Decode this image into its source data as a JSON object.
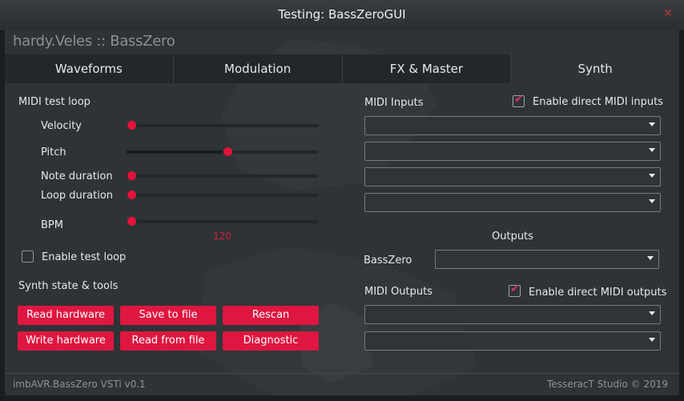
{
  "window": {
    "title": "Testing: BassZeroGUI",
    "close_glyph": "✕"
  },
  "brand": "hardy.Veles :: BassZero",
  "tabs": [
    {
      "label": "Waveforms",
      "active": false
    },
    {
      "label": "Modulation",
      "active": false
    },
    {
      "label": "FX & Master",
      "active": false
    },
    {
      "label": "Synth",
      "active": true
    }
  ],
  "midi_test_loop": {
    "heading": "MIDI test loop",
    "sliders": {
      "velocity": {
        "label": "Velocity",
        "value": 0.0
      },
      "pitch": {
        "label": "Pitch",
        "value": 0.5
      },
      "note_duration": {
        "label": "Note duration",
        "value": 0.0
      },
      "loop_duration": {
        "label": "Loop duration",
        "value": 0.0
      },
      "bpm": {
        "label": "BPM",
        "value": 0.0,
        "display": "120"
      }
    },
    "enable_test_loop": {
      "label": "Enable test loop",
      "checked": false
    }
  },
  "synth_tools": {
    "heading": "Synth state & tools",
    "buttons": {
      "read_hardware": "Read hardware",
      "save_to_file": "Save to file",
      "rescan": "Rescan",
      "write_hardware": "Write hardware",
      "read_from_file": "Read from file",
      "diagnostic": "Diagnostic"
    }
  },
  "midi_inputs": {
    "heading": "MIDI Inputs",
    "enable_direct": {
      "label": "Enable direct MIDI inputs",
      "checked": true
    },
    "dropdowns": [
      "",
      "",
      "",
      ""
    ]
  },
  "outputs": {
    "heading": "Outputs",
    "basszero_label": "BassZero",
    "basszero_value": ""
  },
  "midi_outputs": {
    "heading": "MIDI Outputs",
    "enable_direct": {
      "label": "Enable direct MIDI outputs",
      "checked": true
    },
    "dropdowns": [
      "",
      ""
    ]
  },
  "footer": {
    "left": "imbAVR.BassZero VSTi v0.1",
    "right": "TesseracT Studio © 2019"
  },
  "colors": {
    "accent": "#df1640",
    "panel": "#2e3336",
    "check": "#d0346a"
  }
}
